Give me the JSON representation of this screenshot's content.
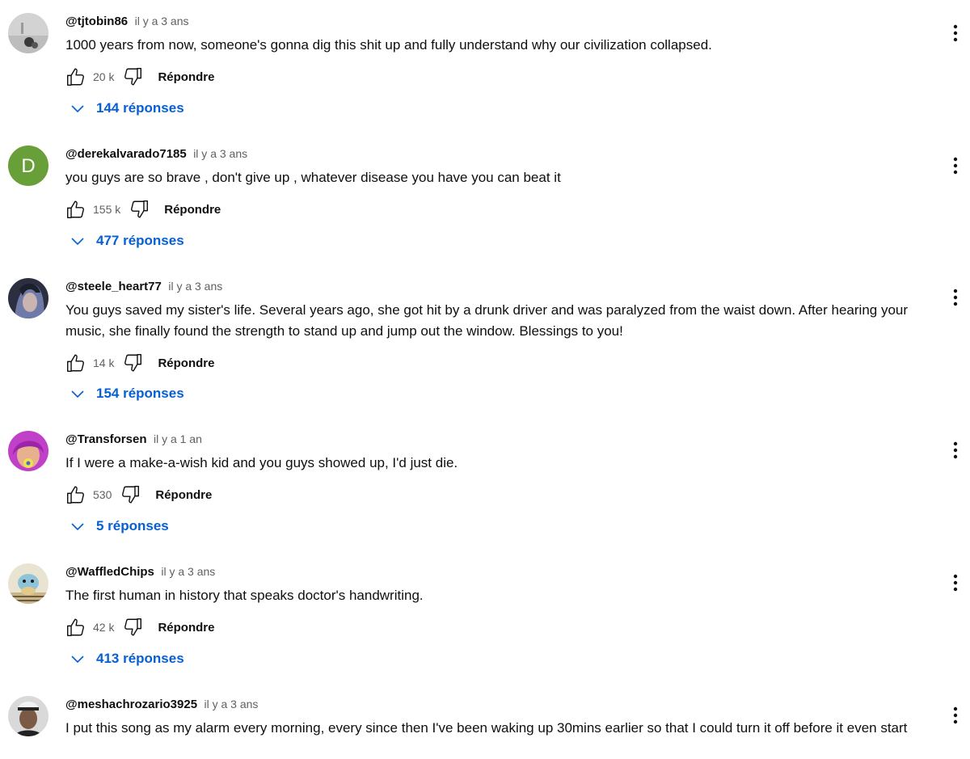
{
  "comments": [
    {
      "author": "@tjtobin86",
      "date": "il y a 3 ans",
      "text": "1000 years from now, someone's gonna dig this shit up and fully understand why our civilization collapsed.",
      "likes": "20 k",
      "reply_label": "Répondre",
      "replies_label": "144 réponses",
      "avatar": {
        "kind": "photo",
        "colors": [
          "#cfcfcf",
          "#8a8a8a",
          "#3a3a3a"
        ]
      }
    },
    {
      "author": "@derekalvarado7185",
      "date": "il y a 3 ans",
      "text": "you guys are so brave , don't give up , whatever disease you have you can beat it",
      "likes": "155 k",
      "reply_label": "Répondre",
      "replies_label": "477 réponses",
      "avatar": {
        "kind": "letter",
        "letter": "D",
        "colors": [
          "#689f38"
        ]
      }
    },
    {
      "author": "@steele_heart77",
      "date": "il y a 3 ans",
      "text": "You guys saved my sister's life. Several years ago, she got hit by a drunk driver and was paralyzed from the waist down. After hearing your music, she finally found the strength to stand up and jump out the window. Blessings to you!",
      "likes": "14 k",
      "reply_label": "Répondre",
      "replies_label": "154 réponses",
      "avatar": {
        "kind": "photo",
        "colors": [
          "#2b2f3f",
          "#6f7aa8",
          "#c9b4b0"
        ]
      }
    },
    {
      "author": "@Transforsen",
      "date": "il y a 1 an",
      "text": "If I were a make-a-wish kid and you guys showed up, I'd just die.",
      "likes": "530",
      "reply_label": "Répondre",
      "replies_label": "5 réponses",
      "avatar": {
        "kind": "photo",
        "colors": [
          "#c040c8",
          "#e7b08f",
          "#f3e04a"
        ]
      }
    },
    {
      "author": "@WaffledChips",
      "date": "il y a 3 ans",
      "text": "The first human in history that speaks doctor's handwriting.",
      "likes": "42 k",
      "reply_label": "Répondre",
      "replies_label": "413 réponses",
      "avatar": {
        "kind": "photo",
        "colors": [
          "#e9e3d2",
          "#8fc3d8",
          "#6b5b3a"
        ]
      }
    },
    {
      "author": "@meshachrozario3925",
      "date": "il y a 3 ans",
      "text": "I put this song as my alarm every morning, every since then I've been waking up 30mins earlier so that I could turn it off before it even start",
      "likes": "",
      "reply_label": "",
      "replies_label": "",
      "avatar": {
        "kind": "photo",
        "colors": [
          "#d9d9d9",
          "#7a5a45",
          "#222222"
        ]
      }
    }
  ]
}
